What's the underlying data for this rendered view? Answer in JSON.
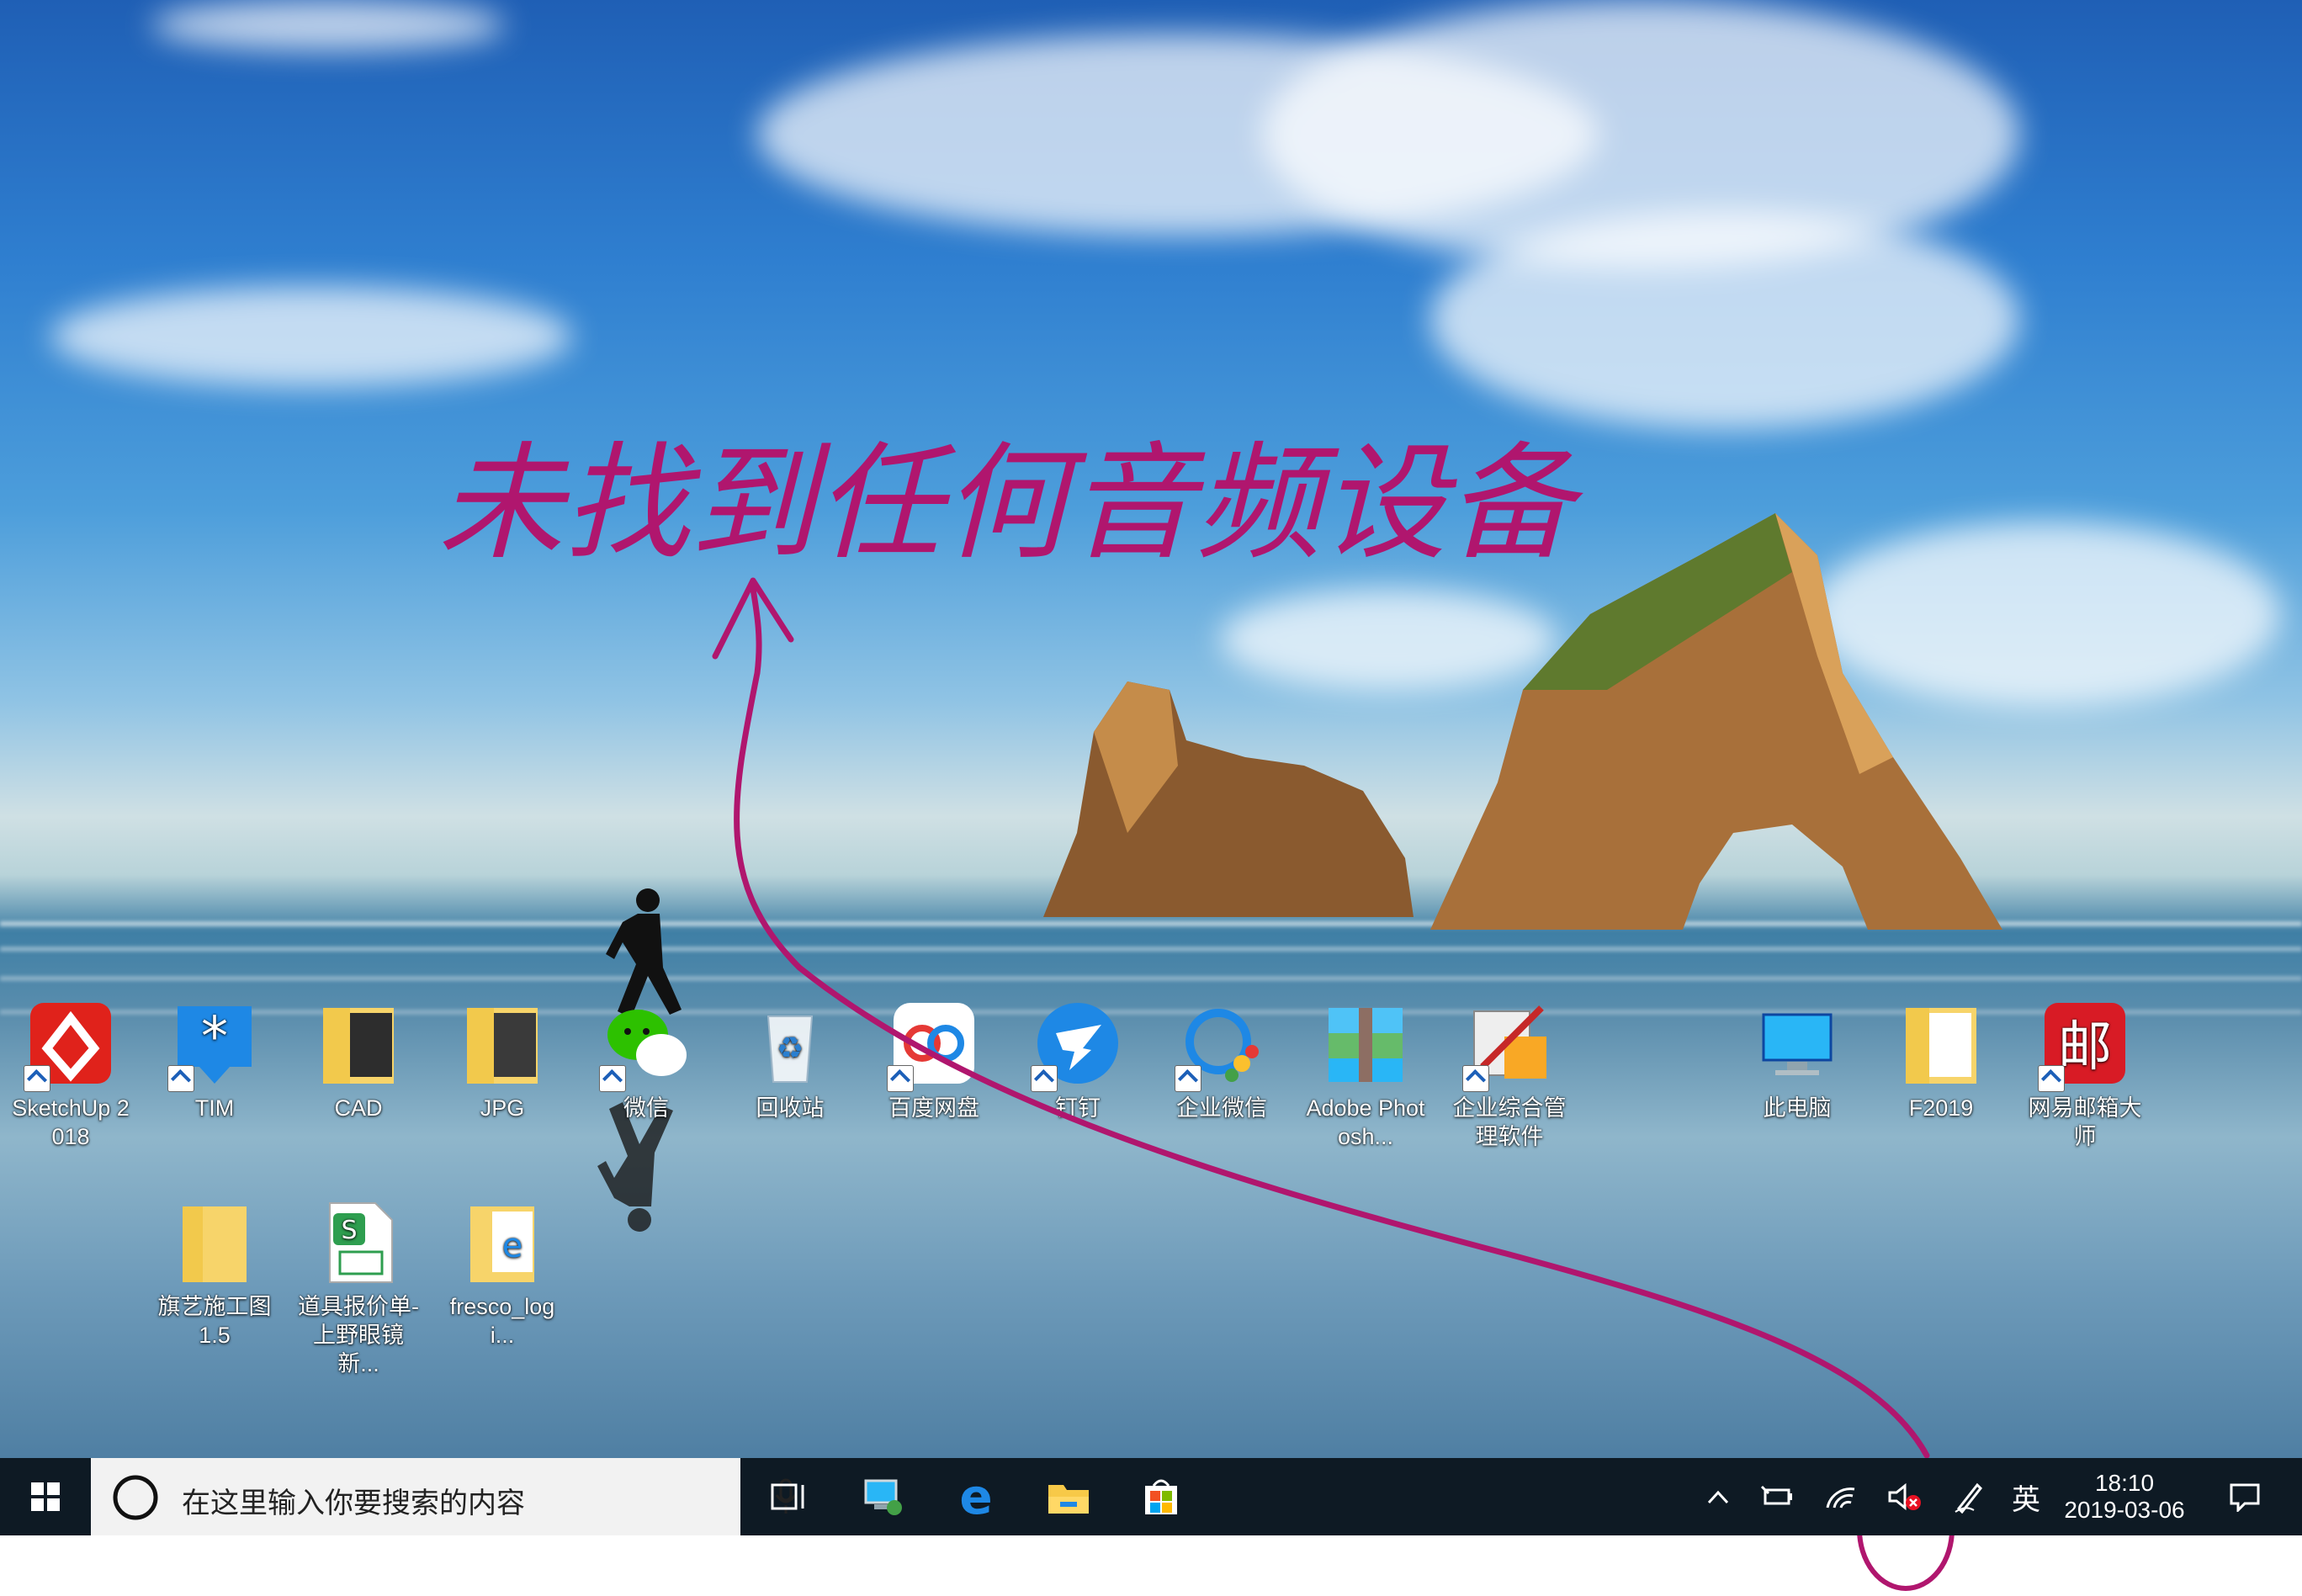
{
  "annotation": {
    "handwritten_text": "未找到任何音频设备",
    "color": "#b0166e"
  },
  "desktop_icons": [
    {
      "name": "SketchUp 2018",
      "icon": "sketchup-icon",
      "shortcut": true
    },
    {
      "name": "TIM",
      "icon": "tim-icon",
      "shortcut": true
    },
    {
      "name": "CAD",
      "icon": "folder-icon",
      "shortcut": false
    },
    {
      "name": "JPG",
      "icon": "folder-icon",
      "shortcut": false
    },
    {
      "name": "微信",
      "icon": "wechat-icon",
      "shortcut": true
    },
    {
      "name": "回收站",
      "icon": "recycle-bin-icon",
      "shortcut": false
    },
    {
      "name": "百度网盘",
      "icon": "baidu-netdisk-icon",
      "shortcut": true
    },
    {
      "name": "钉钉",
      "icon": "dingtalk-icon",
      "shortcut": true
    },
    {
      "name": "企业微信",
      "icon": "wecom-icon",
      "shortcut": true
    },
    {
      "name": "Adobe Photosh...",
      "icon": "archive-icon",
      "shortcut": false
    },
    {
      "name": "企业综合管理软件",
      "icon": "management-software-icon",
      "shortcut": true
    },
    {
      "name": "此电脑",
      "icon": "this-pc-icon",
      "shortcut": false
    },
    {
      "name": "F2019",
      "icon": "folder-icon",
      "shortcut": false
    },
    {
      "name": "网易邮箱大师",
      "icon": "netease-mail-icon",
      "shortcut": true
    },
    {
      "name": "旗艺施工图 1.5",
      "icon": "folder-icon",
      "shortcut": false
    },
    {
      "name": "道具报价单-上野眼镜新...",
      "icon": "spreadsheet-icon",
      "shortcut": false
    },
    {
      "name": "fresco_logi...",
      "icon": "folder-edge-icon",
      "shortcut": false
    }
  ],
  "taskbar": {
    "search_placeholder": "在这里输入你要搜索的内容",
    "pinned": [
      "task-view-icon",
      "remote-desktop-icon",
      "edge-icon",
      "file-explorer-icon",
      "store-icon"
    ],
    "tray": {
      "input_language": "英",
      "time": "18:10",
      "date": "2019-03-06",
      "volume_status": "no-audio-device"
    }
  },
  "colors": {
    "taskbar_bg": "#0e1a24",
    "search_bg": "#f2f2f2",
    "annotation": "#b0166e",
    "error_badge": "#e81123"
  }
}
